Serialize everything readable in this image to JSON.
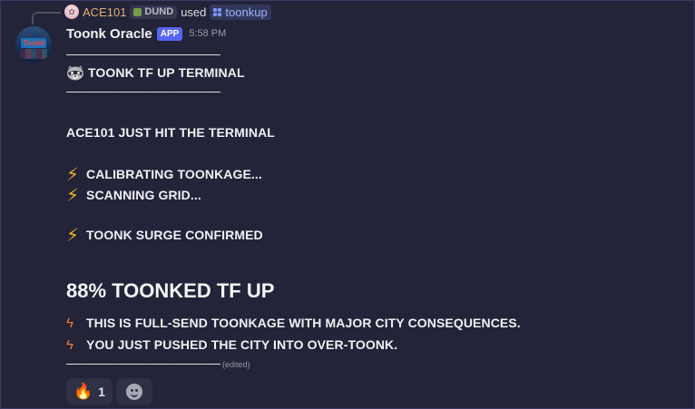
{
  "reply": {
    "username": "ACE101",
    "guild_tag": "DUND",
    "used_text": "used",
    "command": "toonkup",
    "avatar_icon": "user-avatar-icon"
  },
  "message": {
    "author": "Toonk Oracle",
    "badge": "APP",
    "timestamp": "5:58 PM",
    "rule": "——————————————",
    "terminal_title": "TOONK TF UP TERMINAL",
    "title_emoji": "raccoon-icon",
    "hit_line": "ACE101 JUST HIT THE TERMINAL",
    "status_lines": [
      "CALIBRATING TOONKAGE...",
      "SCANNING GRID..."
    ],
    "confirm_line": "TOONK SURGE CONFIRMED",
    "headline": "88% TOONKED TF UP",
    "detail_lines": [
      "THIS IS FULL-SEND TOONKAGE WITH MAJOR CITY CONSEQUENCES.",
      "YOU JUST PUSHED THE CITY INTO OVER-TOONK."
    ],
    "edited": "(edited)"
  },
  "reactions": [
    {
      "emoji": "🔥",
      "icon": "fire-icon",
      "count": "1"
    }
  ],
  "icons": {
    "bolt": "⚡",
    "small_bolt": "ϟ"
  },
  "colors": {
    "background": "#232339",
    "app_badge": "#5865f2",
    "reply_username": "#e0b074",
    "command_chip": "#9fb4ff"
  },
  "bot_avatar_text": "Toonk"
}
